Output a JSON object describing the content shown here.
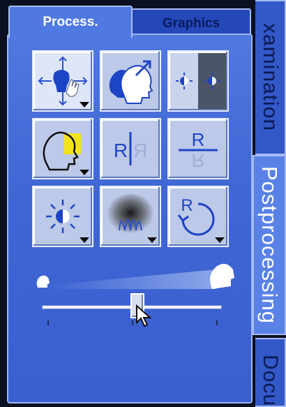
{
  "tabs": {
    "process": "Process.",
    "graphics": "Graphics"
  },
  "side_tabs": {
    "examination": "xamination",
    "postprocessing": "Postprocessing",
    "documentation": "Docu"
  },
  "tools": [
    {
      "name": "move-tool",
      "icon": "move-hand-icon",
      "has_menu": true
    },
    {
      "name": "zoom-tool",
      "icon": "zoom-head-icon",
      "has_menu": false
    },
    {
      "name": "brightness-toggle-tool",
      "icon": "brightness-compare-icon",
      "has_menu": false
    },
    {
      "name": "roi-tool",
      "icon": "head-roi-icon",
      "has_menu": true
    },
    {
      "name": "flip-horizontal-tool",
      "icon": "flip-horizontal-icon",
      "has_menu": false
    },
    {
      "name": "flip-vertical-tool",
      "icon": "flip-vertical-icon",
      "has_menu": false
    },
    {
      "name": "window-level-tool",
      "icon": "sun-icon",
      "has_menu": true
    },
    {
      "name": "filter-tool",
      "icon": "filter-icon",
      "has_menu": true
    },
    {
      "name": "rotate-tool",
      "icon": "rotate-icon",
      "has_menu": true
    }
  ],
  "icon_letters": {
    "flip_h_left": "R",
    "flip_h_right": "R",
    "flip_v_top": "R",
    "flip_v_bottom": "R",
    "rotate": "R"
  },
  "slider": {
    "value": 0.53
  },
  "colors": {
    "panel": "#4f78e0",
    "tab_inactive": "#2448b8",
    "tool_bg": "#bcc9e8",
    "accent_yellow": "#f2e21c",
    "icon_blue": "#1f46c9"
  }
}
